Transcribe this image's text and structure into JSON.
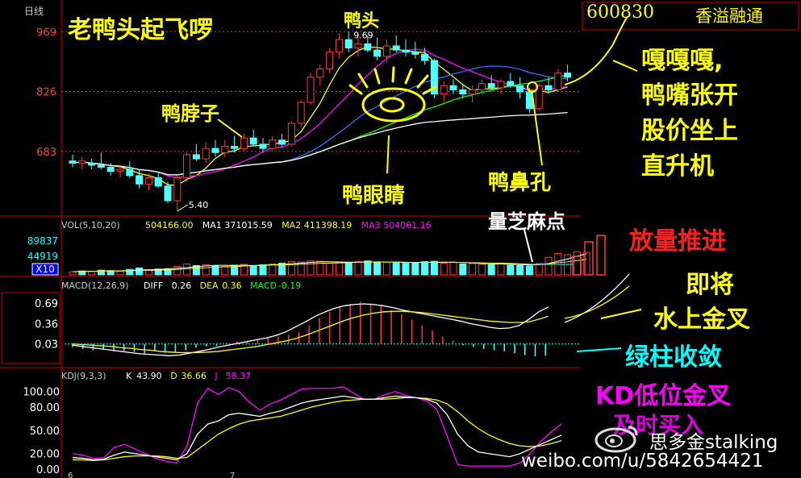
{
  "header": {
    "period_label": "日线",
    "code": "600830",
    "name": "香溢融通"
  },
  "annotations": {
    "title": "老鸭头起飞啰",
    "duck_head": "鸭头",
    "duck_neck": "鸭脖子",
    "duck_eye": "鸭眼睛",
    "duck_nostril": "鸭鼻孔",
    "sesame_dots": "量芝麻点",
    "quack": [
      "嘎嘎嘎,",
      "鸭嘴张开",
      "股价坐上",
      "直升机"
    ],
    "volume_push": "放量推进",
    "golden_cross_soon": [
      "即将",
      "水上金叉"
    ],
    "green_converge": "绿柱收敛",
    "kd_cross": "KD低位金叉",
    "kd_buy": "及时买入"
  },
  "watermark": {
    "author": "思多金stalking",
    "url": "weibo.com/u/5842654421"
  },
  "colors": {
    "up": "#ff3b3b",
    "down": "#54ffff",
    "ma_white": "#ffffff",
    "ma_yellow": "#ffff00",
    "ma_magenta": "#ff00ff",
    "ma_green": "#00ff00",
    "ma_blue": "#3b6bff",
    "title_yellow": "#ffff00",
    "red_text": "#ff2020",
    "magenta_text": "#ff00ff",
    "cyan_text": "#00ffff"
  },
  "chart_data": [
    {
      "type": "candlestick",
      "panel": "price",
      "y_ticks": [
        "969",
        "826",
        "683"
      ],
      "ylim": [
        5.4,
        10.1
      ],
      "high_label": "9.69",
      "low_label": "5.40",
      "x_ticks": [
        "6",
        "7"
      ],
      "candles": [
        {
          "o": 6.6,
          "h": 6.75,
          "l": 6.45,
          "c": 6.55
        },
        {
          "o": 6.55,
          "h": 6.7,
          "l": 6.4,
          "c": 6.6
        },
        {
          "o": 6.55,
          "h": 6.65,
          "l": 6.4,
          "c": 6.5
        },
        {
          "o": 6.5,
          "h": 6.8,
          "l": 6.4,
          "c": 6.45
        },
        {
          "o": 6.45,
          "h": 6.55,
          "l": 6.25,
          "c": 6.35
        },
        {
          "o": 6.35,
          "h": 6.5,
          "l": 6.2,
          "c": 6.4
        },
        {
          "o": 6.4,
          "h": 6.6,
          "l": 6.2,
          "c": 6.25
        },
        {
          "o": 6.25,
          "h": 6.4,
          "l": 5.95,
          "c": 6.05
        },
        {
          "o": 6.05,
          "h": 6.3,
          "l": 5.9,
          "c": 6.2
        },
        {
          "o": 6.2,
          "h": 6.35,
          "l": 5.95,
          "c": 6.0
        },
        {
          "o": 6.0,
          "h": 6.1,
          "l": 5.6,
          "c": 5.65
        },
        {
          "o": 5.65,
          "h": 6.25,
          "l": 5.4,
          "c": 6.2
        },
        {
          "o": 6.2,
          "h": 6.8,
          "l": 6.1,
          "c": 6.75
        },
        {
          "o": 6.75,
          "h": 7.0,
          "l": 6.6,
          "c": 6.65
        },
        {
          "o": 6.65,
          "h": 7.05,
          "l": 6.55,
          "c": 6.9
        },
        {
          "o": 6.9,
          "h": 7.1,
          "l": 6.7,
          "c": 6.8
        },
        {
          "o": 6.8,
          "h": 7.1,
          "l": 6.7,
          "c": 6.95
        },
        {
          "o": 6.95,
          "h": 7.2,
          "l": 6.8,
          "c": 6.9
        },
        {
          "o": 6.9,
          "h": 7.25,
          "l": 6.85,
          "c": 7.15
        },
        {
          "o": 7.15,
          "h": 7.35,
          "l": 6.95,
          "c": 7.0
        },
        {
          "o": 7.0,
          "h": 7.15,
          "l": 6.8,
          "c": 6.9
        },
        {
          "o": 6.9,
          "h": 7.2,
          "l": 6.85,
          "c": 7.1
        },
        {
          "o": 7.1,
          "h": 7.25,
          "l": 6.95,
          "c": 7.0
        },
        {
          "o": 7.0,
          "h": 7.55,
          "l": 6.95,
          "c": 7.5
        },
        {
          "o": 7.5,
          "h": 8.05,
          "l": 7.4,
          "c": 8.0
        },
        {
          "o": 8.0,
          "h": 8.7,
          "l": 7.95,
          "c": 8.6
        },
        {
          "o": 8.6,
          "h": 8.9,
          "l": 8.4,
          "c": 8.8
        },
        {
          "o": 8.8,
          "h": 9.3,
          "l": 8.7,
          "c": 9.2
        },
        {
          "o": 9.2,
          "h": 9.65,
          "l": 9.05,
          "c": 9.5
        },
        {
          "o": 9.5,
          "h": 9.69,
          "l": 9.2,
          "c": 9.3
        },
        {
          "o": 9.3,
          "h": 9.65,
          "l": 9.1,
          "c": 9.4
        },
        {
          "o": 9.4,
          "h": 9.6,
          "l": 9.2,
          "c": 9.25
        },
        {
          "o": 9.25,
          "h": 9.55,
          "l": 9.0,
          "c": 9.1
        },
        {
          "o": 9.1,
          "h": 9.5,
          "l": 8.95,
          "c": 9.35
        },
        {
          "o": 9.35,
          "h": 9.6,
          "l": 9.2,
          "c": 9.25
        },
        {
          "o": 9.25,
          "h": 9.5,
          "l": 9.1,
          "c": 9.2
        },
        {
          "o": 9.2,
          "h": 9.45,
          "l": 9.05,
          "c": 9.15
        },
        {
          "o": 9.15,
          "h": 9.3,
          "l": 8.9,
          "c": 9.0
        },
        {
          "o": 9.0,
          "h": 9.05,
          "l": 8.1,
          "c": 8.2
        },
        {
          "o": 8.2,
          "h": 8.5,
          "l": 8.0,
          "c": 8.4
        },
        {
          "o": 8.4,
          "h": 8.55,
          "l": 8.2,
          "c": 8.3
        },
        {
          "o": 8.3,
          "h": 8.45,
          "l": 8.1,
          "c": 8.2
        },
        {
          "o": 8.2,
          "h": 8.4,
          "l": 8.0,
          "c": 8.3
        },
        {
          "o": 8.3,
          "h": 8.55,
          "l": 8.2,
          "c": 8.45
        },
        {
          "o": 8.45,
          "h": 8.65,
          "l": 8.3,
          "c": 8.35
        },
        {
          "o": 8.35,
          "h": 8.55,
          "l": 8.2,
          "c": 8.5
        },
        {
          "o": 8.5,
          "h": 8.7,
          "l": 8.35,
          "c": 8.4
        },
        {
          "o": 8.4,
          "h": 8.6,
          "l": 8.1,
          "c": 8.25
        },
        {
          "o": 8.25,
          "h": 8.35,
          "l": 7.75,
          "c": 7.85
        },
        {
          "o": 7.85,
          "h": 8.45,
          "l": 7.8,
          "c": 8.4
        },
        {
          "o": 8.4,
          "h": 8.6,
          "l": 8.2,
          "c": 8.3
        },
        {
          "o": 8.3,
          "h": 8.8,
          "l": 8.25,
          "c": 8.7
        },
        {
          "o": 8.7,
          "h": 8.9,
          "l": 8.5,
          "c": 8.6
        }
      ]
    },
    {
      "type": "bar",
      "panel": "volume",
      "header": "VOL(5,10,20)",
      "header_values": [
        {
          "label": "504166.00",
          "color": "#ffff00"
        },
        {
          "label": "MA1",
          "color": "#ffffff"
        },
        {
          "label": "371015.59",
          "color": "#ffffff"
        },
        {
          "label": "MA2",
          "color": "#ffff00"
        },
        {
          "label": "411398.19",
          "color": "#ffff00"
        },
        {
          "label": "MA3",
          "color": "#ff00ff"
        },
        {
          "label": "504061.16",
          "color": "#ff00ff"
        }
      ],
      "y_ticks": [
        "89837",
        "44919"
      ],
      "unit_label": "X10",
      "ylim": [
        0,
        110000
      ],
      "values": [
        8000,
        10000,
        9000,
        12000,
        11000,
        9500,
        14000,
        18000,
        13000,
        15000,
        16000,
        22000,
        28000,
        24000,
        26000,
        23000,
        22000,
        25000,
        27000,
        24000,
        26000,
        28000,
        30000,
        34000,
        33000,
        36000,
        35000,
        30000,
        32000,
        31000,
        34000,
        36000,
        33000,
        32000,
        31000,
        30000,
        32000,
        34000,
        35000,
        30000,
        32000,
        28000,
        29000,
        27000,
        26000,
        30000,
        25000,
        24000,
        23000,
        29000,
        45000,
        55000,
        52000,
        60000,
        58000
      ],
      "up": [
        1,
        0,
        1,
        0,
        0,
        1,
        0,
        0,
        1,
        0,
        0,
        1,
        1,
        0,
        1,
        0,
        1,
        0,
        1,
        0,
        0,
        1,
        0,
        1,
        1,
        1,
        1,
        1,
        1,
        0,
        1,
        0,
        0,
        1,
        0,
        0,
        0,
        0,
        0,
        1,
        1,
        0,
        1,
        1,
        0,
        1,
        0,
        0,
        0,
        1,
        1,
        1,
        1,
        1,
        1
      ]
    },
    {
      "type": "bar",
      "panel": "macd",
      "header": "MACD(12,26,9)",
      "header_values": [
        {
          "label": "DIFF",
          "color": "#ffffff"
        },
        {
          "label": "0.26",
          "color": "#ffffff"
        },
        {
          "label": "DEA",
          "color": "#ffff00"
        },
        {
          "label": "0.36",
          "color": "#ffff00"
        },
        {
          "label": "MACD",
          "color": "#00ff00"
        },
        {
          "label": "-0.19",
          "color": "#00ff00"
        }
      ],
      "y_ticks": [
        "0.69",
        "0.36",
        "0.03"
      ],
      "ylim": [
        -0.3,
        0.85
      ],
      "zero": 0.03,
      "hist": [
        -0.05,
        -0.08,
        -0.1,
        -0.09,
        -0.12,
        -0.11,
        -0.13,
        -0.15,
        -0.12,
        -0.14,
        -0.13,
        -0.1,
        -0.06,
        -0.04,
        -0.03,
        0.02,
        0.04,
        0.05,
        0.07,
        0.1,
        0.12,
        0.15,
        0.2,
        0.3,
        0.42,
        0.52,
        0.6,
        0.65,
        0.68,
        0.66,
        0.62,
        0.55,
        0.48,
        0.4,
        0.3,
        0.22,
        0.12,
        0.06,
        -0.02,
        -0.05,
        -0.08,
        -0.1,
        -0.12,
        -0.15,
        -0.18,
        -0.2,
        -0.19
      ],
      "diff": [
        -0.02,
        -0.04,
        -0.06,
        -0.08,
        -0.1,
        -0.12,
        -0.14,
        -0.16,
        -0.17,
        -0.18,
        -0.19,
        -0.18,
        -0.15,
        -0.12,
        -0.09,
        -0.05,
        -0.02,
        0.01,
        0.04,
        0.07,
        0.1,
        0.14,
        0.2,
        0.28,
        0.36,
        0.45,
        0.52,
        0.58,
        0.62,
        0.64,
        0.65,
        0.64,
        0.62,
        0.59,
        0.55,
        0.52,
        0.49,
        0.46,
        0.43,
        0.4,
        0.37,
        0.33,
        0.3,
        0.27,
        0.25,
        0.26,
        0.3,
        0.4,
        0.52,
        0.6
      ],
      "dea": [
        0.0,
        -0.01,
        -0.02,
        -0.03,
        -0.04,
        -0.06,
        -0.07,
        -0.09,
        -0.1,
        -0.12,
        -0.13,
        -0.14,
        -0.14,
        -0.14,
        -0.13,
        -0.12,
        -0.1,
        -0.08,
        -0.06,
        -0.04,
        -0.01,
        0.02,
        0.05,
        0.09,
        0.14,
        0.2,
        0.26,
        0.32,
        0.38,
        0.43,
        0.47,
        0.5,
        0.52,
        0.53,
        0.53,
        0.52,
        0.51,
        0.49,
        0.47,
        0.45,
        0.43,
        0.41,
        0.39,
        0.37,
        0.36,
        0.35,
        0.35,
        0.36,
        0.4,
        0.45
      ]
    },
    {
      "type": "line",
      "panel": "kdj",
      "header": "KDJ(9,3,3)",
      "header_values": [
        {
          "label": "K",
          "color": "#ffffff"
        },
        {
          "label": "43.90",
          "color": "#ffffff"
        },
        {
          "label": "D",
          "color": "#ffff00"
        },
        {
          "label": "36.66",
          "color": "#ffff00"
        },
        {
          "label": "J",
          "color": "#ff00ff"
        },
        {
          "label": "58.37",
          "color": "#ff00ff"
        }
      ],
      "y_ticks": [
        "100.00",
        "80.00",
        "50.00",
        "20.00",
        "0.00"
      ],
      "ylim": [
        0,
        110
      ],
      "k": [
        15,
        14,
        12,
        13,
        18,
        22,
        20,
        18,
        16,
        14,
        12,
        20,
        45,
        58,
        62,
        70,
        72,
        70,
        68,
        72,
        75,
        80,
        85,
        88,
        90,
        92,
        94,
        92,
        90,
        90,
        92,
        94,
        93,
        92,
        90,
        85,
        70,
        45,
        30,
        22,
        20,
        18,
        16,
        20,
        26,
        32,
        38,
        43.9
      ],
      "d": [
        12,
        12,
        11,
        12,
        14,
        16,
        17,
        17,
        17,
        16,
        14,
        15,
        25,
        35,
        45,
        52,
        58,
        62,
        64,
        66,
        68,
        72,
        76,
        80,
        83,
        86,
        88,
        89,
        90,
        90,
        90,
        91,
        92,
        92,
        91,
        89,
        84,
        74,
        62,
        52,
        44,
        38,
        33,
        30,
        29,
        30,
        33,
        36.66
      ],
      "j": [
        20,
        18,
        14,
        15,
        28,
        32,
        26,
        20,
        14,
        10,
        8,
        30,
        85,
        104,
        96,
        105,
        100,
        86,
        76,
        84,
        89,
        96,
        103,
        104,
        104,
        104,
        106,
        98,
        90,
        90,
        96,
        100,
        95,
        92,
        88,
        77,
        42,
        6,
        4,
        4,
        4,
        4,
        4,
        8,
        20,
        36,
        48,
        58.37
      ]
    }
  ]
}
